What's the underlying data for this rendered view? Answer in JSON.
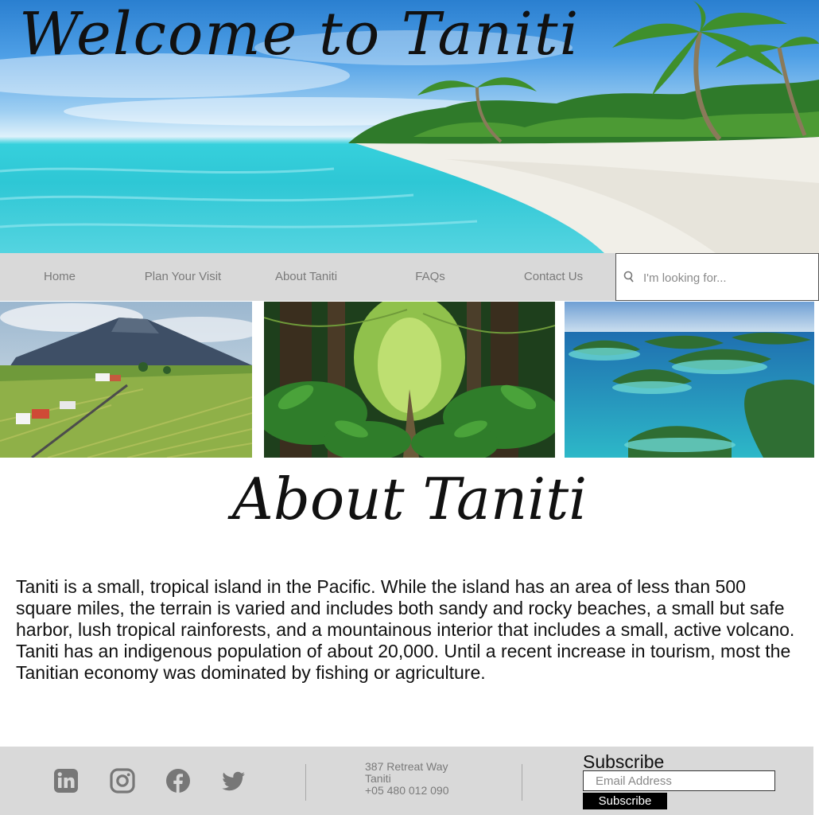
{
  "hero": {
    "title": "Welcome to Taniti",
    "image": "tropical-beach-photo"
  },
  "nav": {
    "items": [
      {
        "label": "Home"
      },
      {
        "label": "Plan Your Visit"
      },
      {
        "label": "About Taniti"
      },
      {
        "label": "FAQs"
      },
      {
        "label": "Contact Us"
      }
    ],
    "search": {
      "placeholder": "I'm looking for...",
      "icon": "search-icon"
    }
  },
  "gallery": [
    {
      "image": "volcano-farmland-photo"
    },
    {
      "image": "rainforest-trail-photo"
    },
    {
      "image": "island-lagoon-photo"
    }
  ],
  "about": {
    "title": "About Taniti",
    "text": "Taniti is a small, tropical island in the Pacific. While the island has an area of less than 500 square miles, the terrain is varied and includes both sandy and rocky beaches, a small but safe harbor, lush tropical rainforests, and a mountainous interior that includes a small, active volcano. Taniti has an indigenous population of about 20,000. Until a recent increase in tourism, most the Tanitian economy was dominated by fishing or agriculture."
  },
  "footer": {
    "social": [
      "linkedin-icon",
      "instagram-icon",
      "facebook-icon",
      "twitter-icon"
    ],
    "address": {
      "street": "387 Retreat Way",
      "city": "Taniti",
      "phone": "+05 480 012 090"
    },
    "subscribe": {
      "heading": "Subscribe",
      "placeholder": "Email Address",
      "button": "Subscribe"
    }
  },
  "colors": {
    "nav_bg": "#d9d9d9",
    "nav_text": "#7a7a7a",
    "footer_bg": "#d9d9d9",
    "icon_gray": "#777777",
    "button_bg": "#000000"
  }
}
